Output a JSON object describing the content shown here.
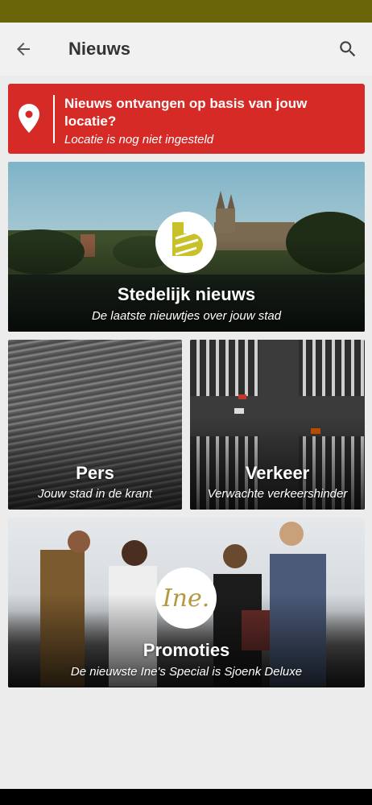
{
  "header": {
    "title": "Nieuws",
    "back_icon": "arrow-left-icon",
    "search_icon": "search-icon"
  },
  "location_banner": {
    "title": "Nieuws ontvangen op basis van jouw locatie?",
    "subtitle": "Locatie is nog niet ingesteld",
    "icon": "location-pin-icon",
    "color": "#d62a26"
  },
  "tiles": [
    {
      "title": "Stedelijk nieuws",
      "subtitle": "De laatste nieuwtjes over jouw stad"
    },
    {
      "title": "Pers",
      "subtitle": "Jouw stad in de krant"
    },
    {
      "title": "Verkeer",
      "subtitle": "Verwachte verkeershinder"
    },
    {
      "title": "Promoties",
      "subtitle": "De nieuwste Ine's Special is Sjoenk Deluxe",
      "logo_text": "Ine."
    }
  ],
  "colors": {
    "status_bar": "#6b650a",
    "app_bar": "#f1f1f1",
    "accent_logo": "#b49a3e"
  }
}
